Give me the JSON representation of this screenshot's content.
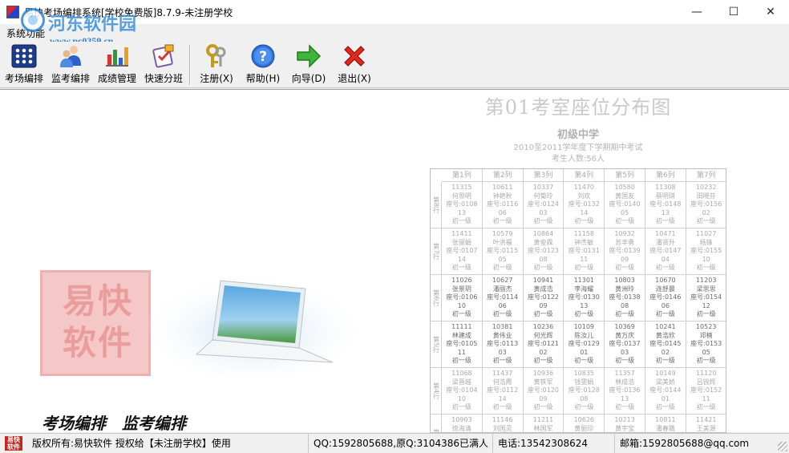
{
  "window": {
    "title": "易快考场编排系统[学校免费版]8.7.9-未注册学校",
    "controls": {
      "minimize": "—",
      "maximize": "☐",
      "close": "✕"
    }
  },
  "watermark": {
    "name": "河东软件园",
    "url": "www.pc0359.cn"
  },
  "menu": {
    "items": [
      {
        "label": "系统功能"
      }
    ]
  },
  "toolbar": {
    "buttons": [
      {
        "label": "考场编排",
        "icon": "exam-room-grid-icon"
      },
      {
        "label": "监考编排",
        "icon": "proctor-users-icon"
      },
      {
        "label": "成绩管理",
        "icon": "bar-chart-icon"
      },
      {
        "label": "快速分班",
        "icon": "class-split-icon"
      },
      {
        "label": "注册(X)",
        "icon": "register-keys-icon"
      },
      {
        "label": "帮助(H)",
        "icon": "help-icon"
      },
      {
        "label": "向导(D)",
        "icon": "wizard-arrow-icon"
      },
      {
        "label": "退出(X)",
        "icon": "exit-x-icon"
      }
    ]
  },
  "content": {
    "decor_text": "易快软件",
    "slogan": "考场编排　监考编排"
  },
  "seating_chart": {
    "title": "第01考室座位分布图",
    "school": "初级中学",
    "exam": "2010至2011学年度下学期期中考试",
    "count": "考生人数:56人",
    "columns": [
      "第1列",
      "第2列",
      "第3列",
      "第4列",
      "第5列",
      "第6列",
      "第7列"
    ],
    "rows": [
      {
        "label": "第8行",
        "cells": [
          [
            "11315",
            "何思明",
            "座号:0108",
            "13",
            "初一级"
          ],
          [
            "10611",
            "钟艳秋",
            "座号:0116",
            "06",
            "初一级"
          ],
          [
            "10337",
            "何菊玲",
            "座号:0124",
            "03",
            "初一级"
          ],
          [
            "11470",
            "刘欢",
            "座号:0132",
            "14",
            "初一级"
          ],
          [
            "10580",
            "黄国友",
            "座号:0140",
            "05",
            "初一级"
          ],
          [
            "11308",
            "蔡明琪",
            "座号:0148",
            "13",
            "初一级"
          ],
          [
            "10232",
            "田晓芬",
            "座号:0156",
            "02",
            "初一级"
          ]
        ]
      },
      {
        "label": "第7行",
        "cells": [
          [
            "11411",
            "张丽娟",
            "座号:0107",
            "14",
            "初一级"
          ],
          [
            "10579",
            "叶洪福",
            "座号:0115",
            "05",
            "初一级"
          ],
          [
            "10864",
            "黄俊霖",
            "座号:0123",
            "08",
            "初一级"
          ],
          [
            "11158",
            "钟杰敏",
            "座号:0131",
            "11",
            "初一级"
          ],
          [
            "10932",
            "苏丰勇",
            "座号:0139",
            "09",
            "初一级"
          ],
          [
            "10471",
            "潘贤升",
            "座号:0147",
            "04",
            "初一级"
          ],
          [
            "11027",
            "杨锋",
            "座号:0155",
            "10",
            "初一级"
          ]
        ]
      },
      {
        "label": "第6行",
        "cells": [
          [
            "11026",
            "张景玥",
            "座号:0106",
            "10",
            "初一级"
          ],
          [
            "10627",
            "潘丽杰",
            "座号:0114",
            "06",
            "初一级"
          ],
          [
            "10941",
            "黄成浩",
            "座号:0122",
            "09",
            "初一级"
          ],
          [
            "11301",
            "李海耀",
            "座号:0130",
            "13",
            "初一级"
          ],
          [
            "10803",
            "黄洲玲",
            "座号:0138",
            "08",
            "初一级"
          ],
          [
            "10670",
            "连舒晨",
            "座号:0146",
            "06",
            "初一级"
          ],
          [
            "11203",
            "梁思思",
            "座号:0154",
            "12",
            "初一级"
          ]
        ]
      },
      {
        "label": "第5行",
        "cells": [
          [
            "11111",
            "林建成",
            "座号:0105",
            "11",
            "初一级"
          ],
          [
            "10381",
            "黄伟业",
            "座号:0113",
            "03",
            "初一级"
          ],
          [
            "10236",
            "何光辉",
            "座号:0121",
            "02",
            "初一级"
          ],
          [
            "10109",
            "陈汝儿",
            "座号:0129",
            "01",
            "初一级"
          ],
          [
            "10369",
            "黄万庆",
            "座号:0137",
            "03",
            "初一级"
          ],
          [
            "10241",
            "黄浩欣",
            "座号:0145",
            "02",
            "初一级"
          ],
          [
            "10523",
            "邓楠",
            "座号:0153",
            "05",
            "初一级"
          ]
        ]
      },
      {
        "label": "第4行",
        "cells": [
          [
            "11068",
            "梁晋越",
            "座号:0104",
            "10",
            "初一级"
          ],
          [
            "11437",
            "何浩霞",
            "座号:0112",
            "14",
            "初一级"
          ],
          [
            "10936",
            "黄铁军",
            "座号:0120",
            "09",
            "初一级"
          ],
          [
            "10835",
            "钱雯娟",
            "座号:0128",
            "08",
            "初一级"
          ],
          [
            "11357",
            "林成浩",
            "座号:0136",
            "13",
            "初一级"
          ],
          [
            "10149",
            "梁美娇",
            "座号:0144",
            "01",
            "初一级"
          ],
          [
            "11120",
            "吕锐辉",
            "座号:0152",
            "11",
            "初一级"
          ]
        ]
      },
      {
        "label": "第3行",
        "cells": [
          [
            "10903",
            "徐海清",
            "座号:0103",
            "09",
            "初一级"
          ],
          [
            "11146",
            "刘国灵",
            "座号:0111",
            "11",
            "初一级"
          ],
          [
            "11211",
            "林国军",
            "座号:0119",
            "12",
            "初一级"
          ],
          [
            "10626",
            "黄丽珍",
            "座号:0127",
            "06",
            "初一级"
          ],
          [
            "10213",
            "黄宇宝",
            "座号:0135",
            "02",
            "初一级"
          ],
          [
            "10811",
            "潘春娥",
            "座号:0143",
            "08",
            "初一级"
          ],
          [
            "11421",
            "王美源",
            "座号:0151",
            "14",
            "初一级"
          ]
        ]
      }
    ]
  },
  "status": {
    "icon_text": "易快软件",
    "copyright": "版权所有:易快软件 授权给【未注册学校】使用",
    "qq": "QQ:1592805688,原Q:3104386已满人",
    "phone": "电话:13542308624",
    "email": "邮箱:1592805688@qq.com"
  }
}
